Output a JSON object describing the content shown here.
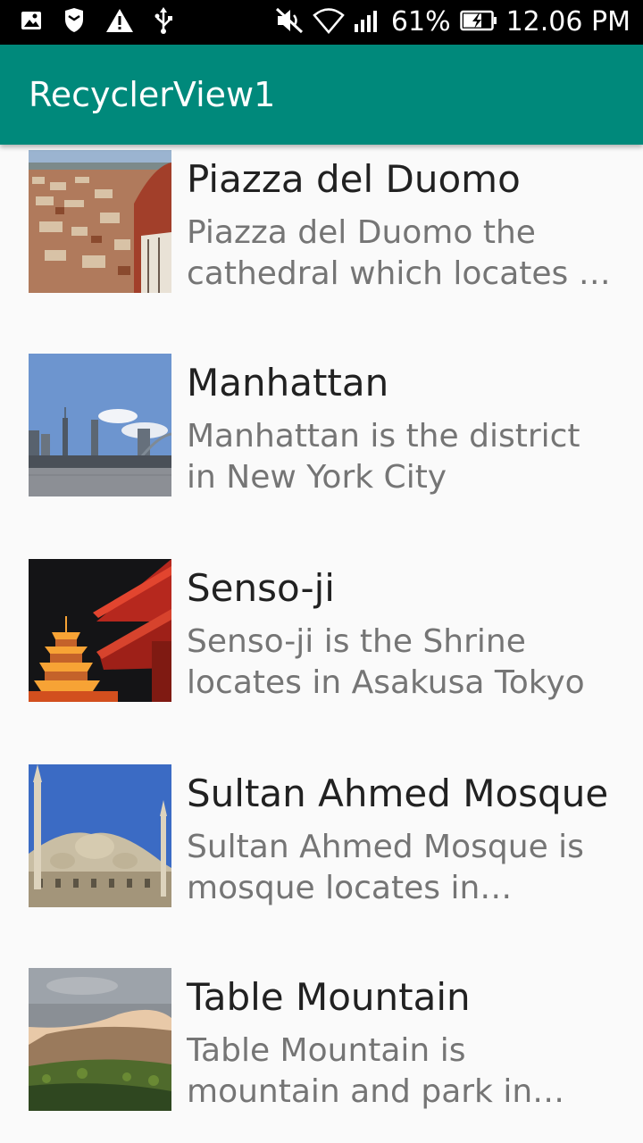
{
  "status_bar": {
    "battery_percent": "61%",
    "time": "12.06 PM",
    "icons": [
      "image-icon",
      "shield-icon",
      "warning-icon",
      "usb-icon",
      "mute-icon",
      "wifi-icon",
      "signal-icon",
      "battery-icon"
    ]
  },
  "app_bar": {
    "title": "RecyclerView1"
  },
  "items": [
    {
      "title": "Piazza del Duomo",
      "description": "Piazza del Duomo the cathedral which locates in Florence"
    },
    {
      "title": "Manhattan",
      "description": "Manhattan is the district in New York City"
    },
    {
      "title": "Senso-ji",
      "description": "Senso-ji is the Shrine locates in Asakusa Tokyo"
    },
    {
      "title": "Sultan Ahmed Mosque",
      "description": "Sultan Ahmed Mosque is mosque locates in Istanbul"
    },
    {
      "title": "Table Mountain",
      "description": "Table Mountain is mountain and park in Cape Town"
    }
  ]
}
